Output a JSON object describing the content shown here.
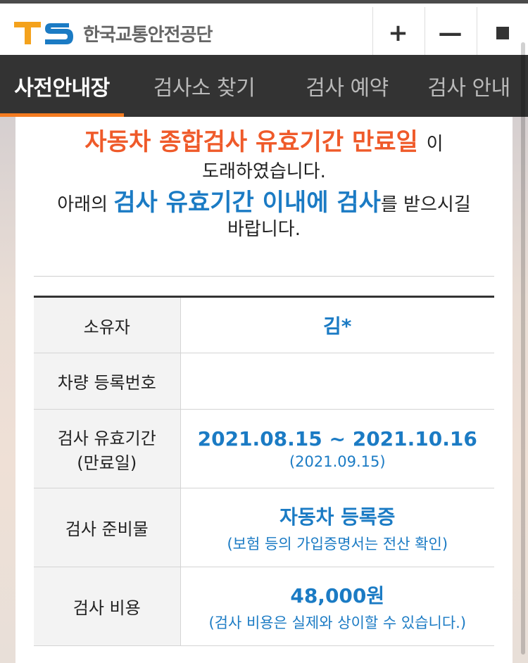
{
  "header": {
    "logo_letters": "TS",
    "logo_text": "한국교통안전공단",
    "plus_label": "+",
    "minus_label": "—",
    "colors": {
      "logo_t": "#f4a21c",
      "logo_s": "#1b7bc4"
    }
  },
  "nav": {
    "items": [
      {
        "label": "사전안내장"
      },
      {
        "label": "검사소 찾기"
      },
      {
        "label": "검사 예약"
      },
      {
        "label": "검사 안내"
      }
    ],
    "active_index": 0,
    "colors": {
      "background": "#333333",
      "active_underline": "#f47b20"
    }
  },
  "notice": {
    "line1_highlight": "자동차 종합검사 유효기간 만료일",
    "line1_suffix": "이",
    "line2": "도래하였습니다.",
    "line3_prefix": "아래의",
    "line3_highlight": "검사 유효기간 이내에 검사",
    "line3_suffix": "를 받으시길",
    "line4": "바랍니다."
  },
  "table": {
    "rows": [
      {
        "label": "소유자",
        "value": "김*",
        "sub": ""
      },
      {
        "label": "차량 등록번호",
        "value": "",
        "sub": ""
      },
      {
        "label_line1": "검사 유효기간",
        "label_line2": "(만료일)",
        "value": "2021.08.15 ~ 2021.10.16",
        "sub": "(2021.09.15)"
      },
      {
        "label": "검사 준비물",
        "value": "자동차 등록증",
        "sub": "(보험 등의 가입증명서는 전산 확인)"
      },
      {
        "label": "검사 비용",
        "value": "48,000원",
        "sub": "(검사 비용은 실제와 상이할 수 있습니다.)"
      }
    ]
  }
}
